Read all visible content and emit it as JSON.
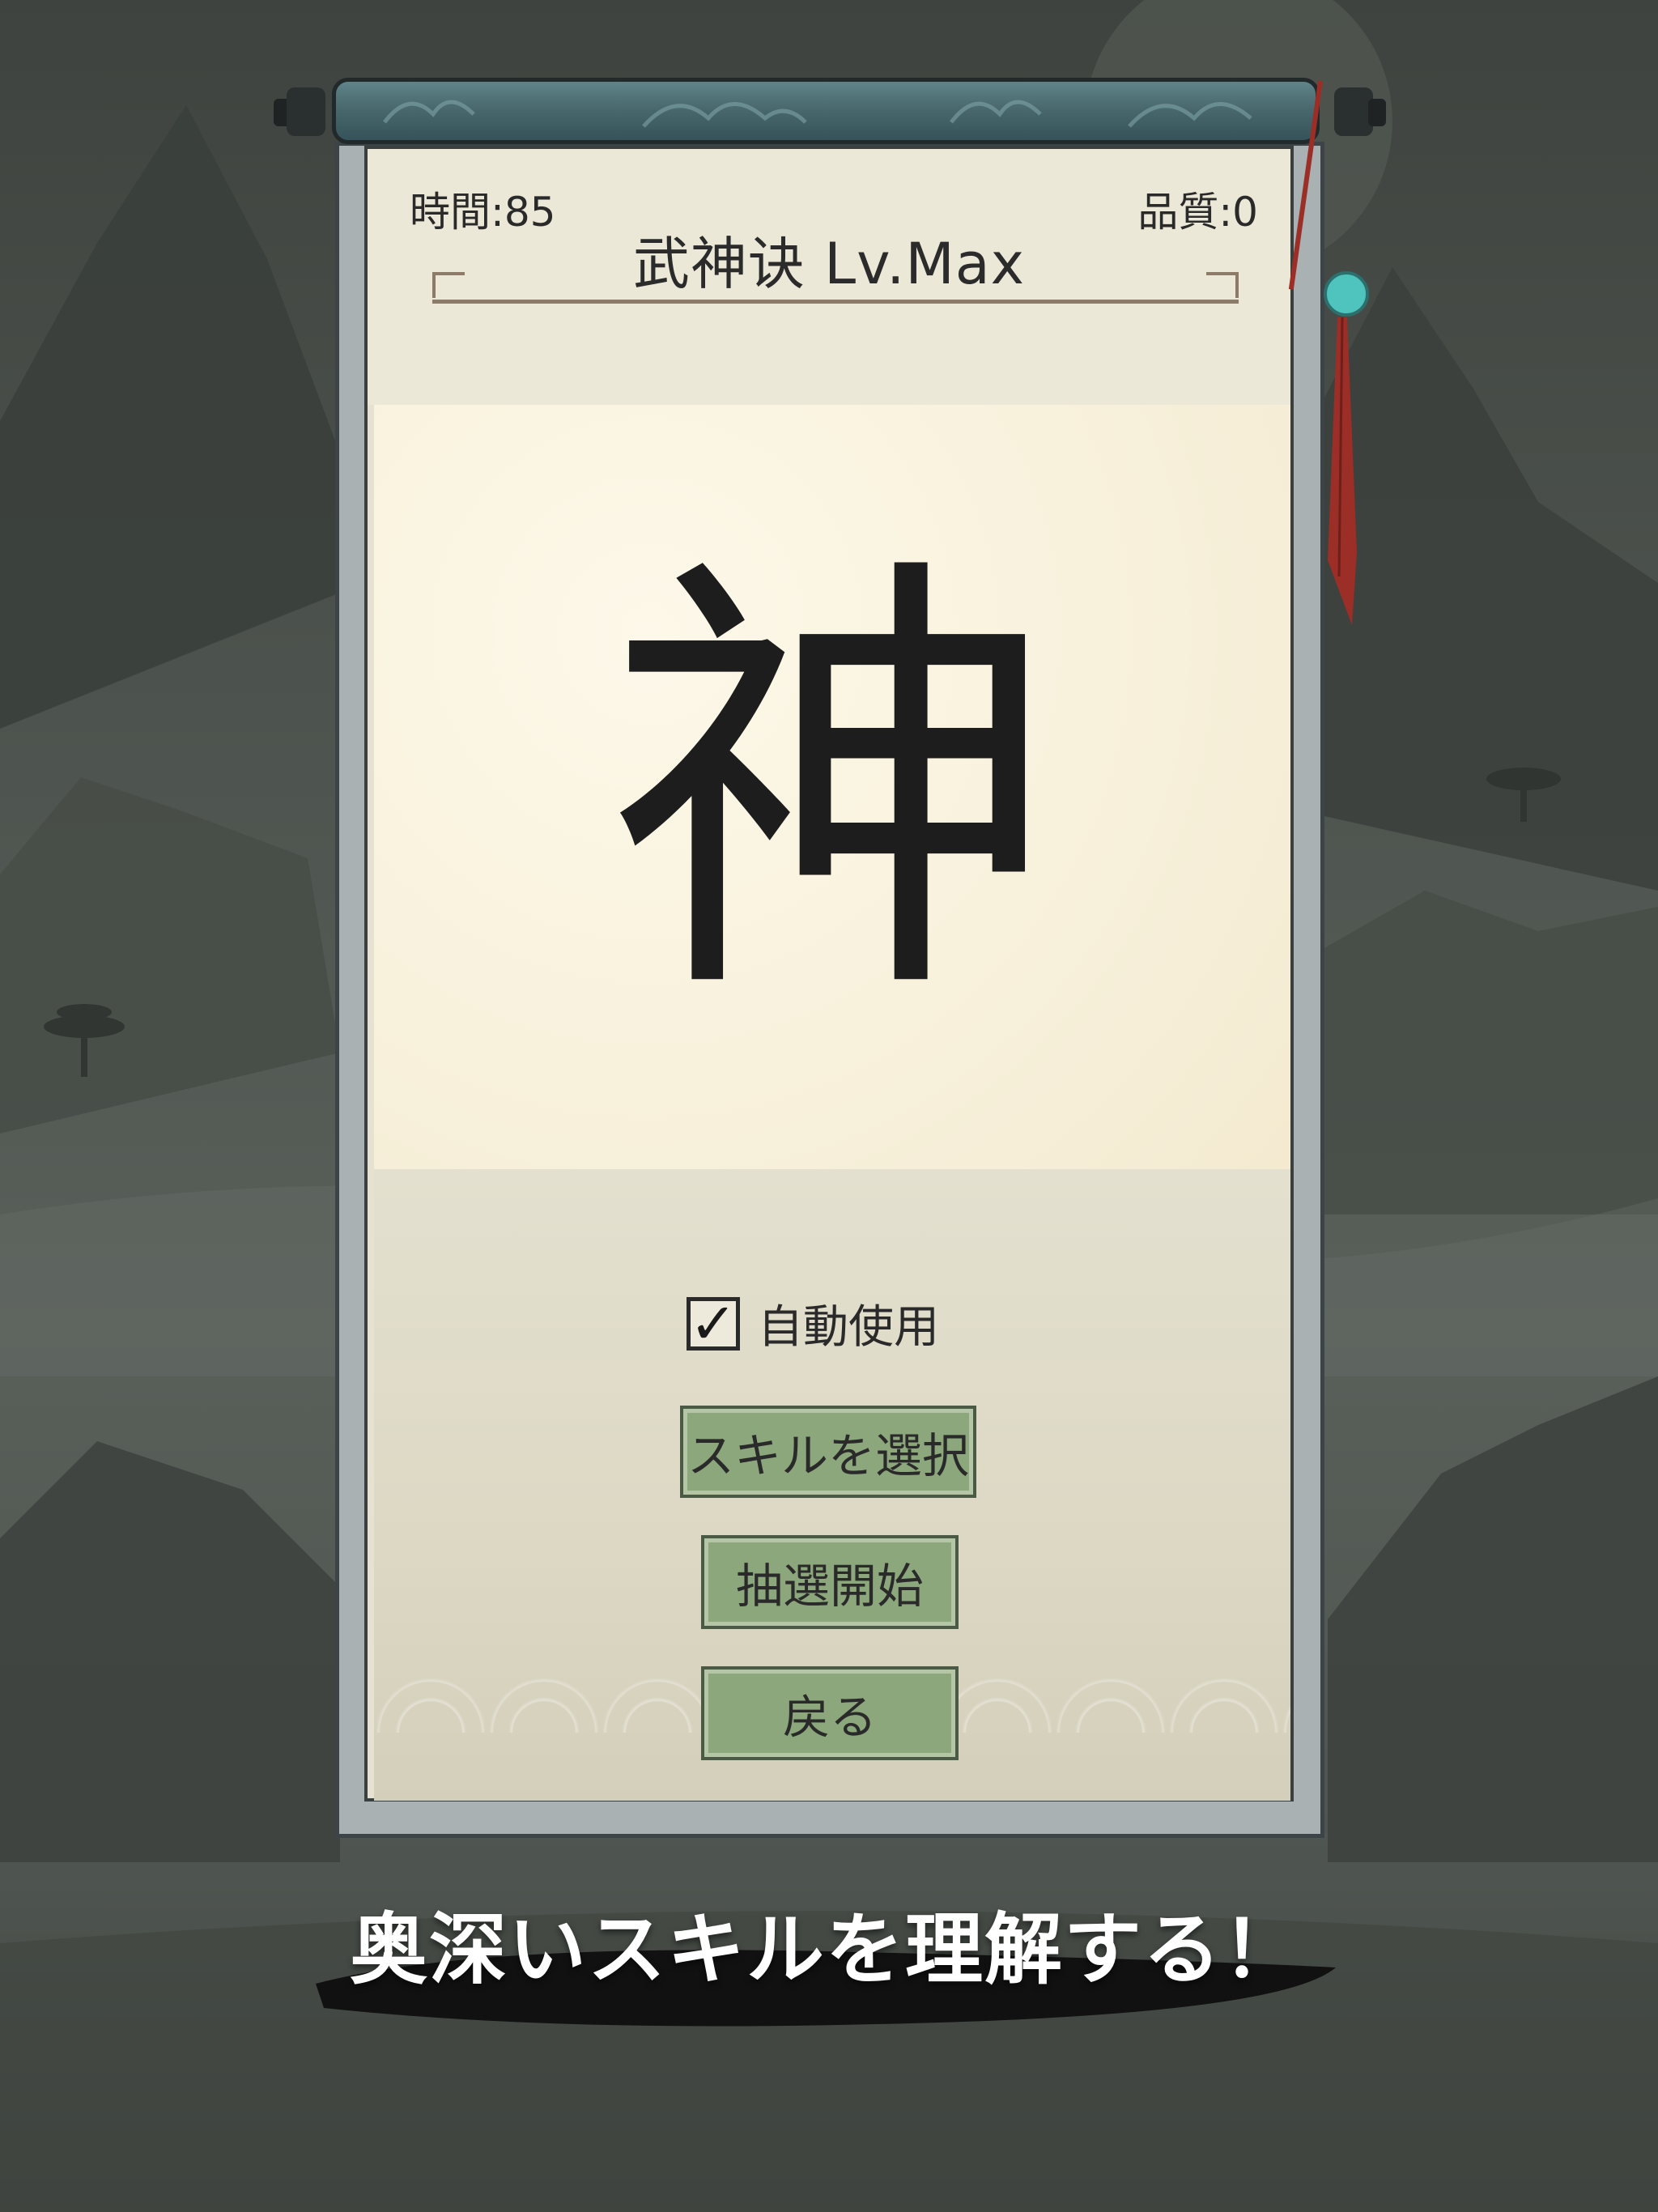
{
  "hud": {
    "time_label": "時間:85",
    "quality_label": "品質:0"
  },
  "skill": {
    "title": "武神诀 Lv.Max",
    "glyph": "神"
  },
  "options": {
    "auto_use_label": "自動使用",
    "auto_use_checked": true,
    "check_mark": "✓"
  },
  "buttons": {
    "select_skill": "スキルを選択",
    "start_draw": "抽選開始",
    "back": "戻る"
  },
  "caption": "奥深いスキルを理解する！",
  "colors": {
    "button_green": "#8ba77b",
    "bead_cyan": "#4fc3bd",
    "tassel_red": "#9b2e26",
    "rod_teal": "#49696e"
  }
}
